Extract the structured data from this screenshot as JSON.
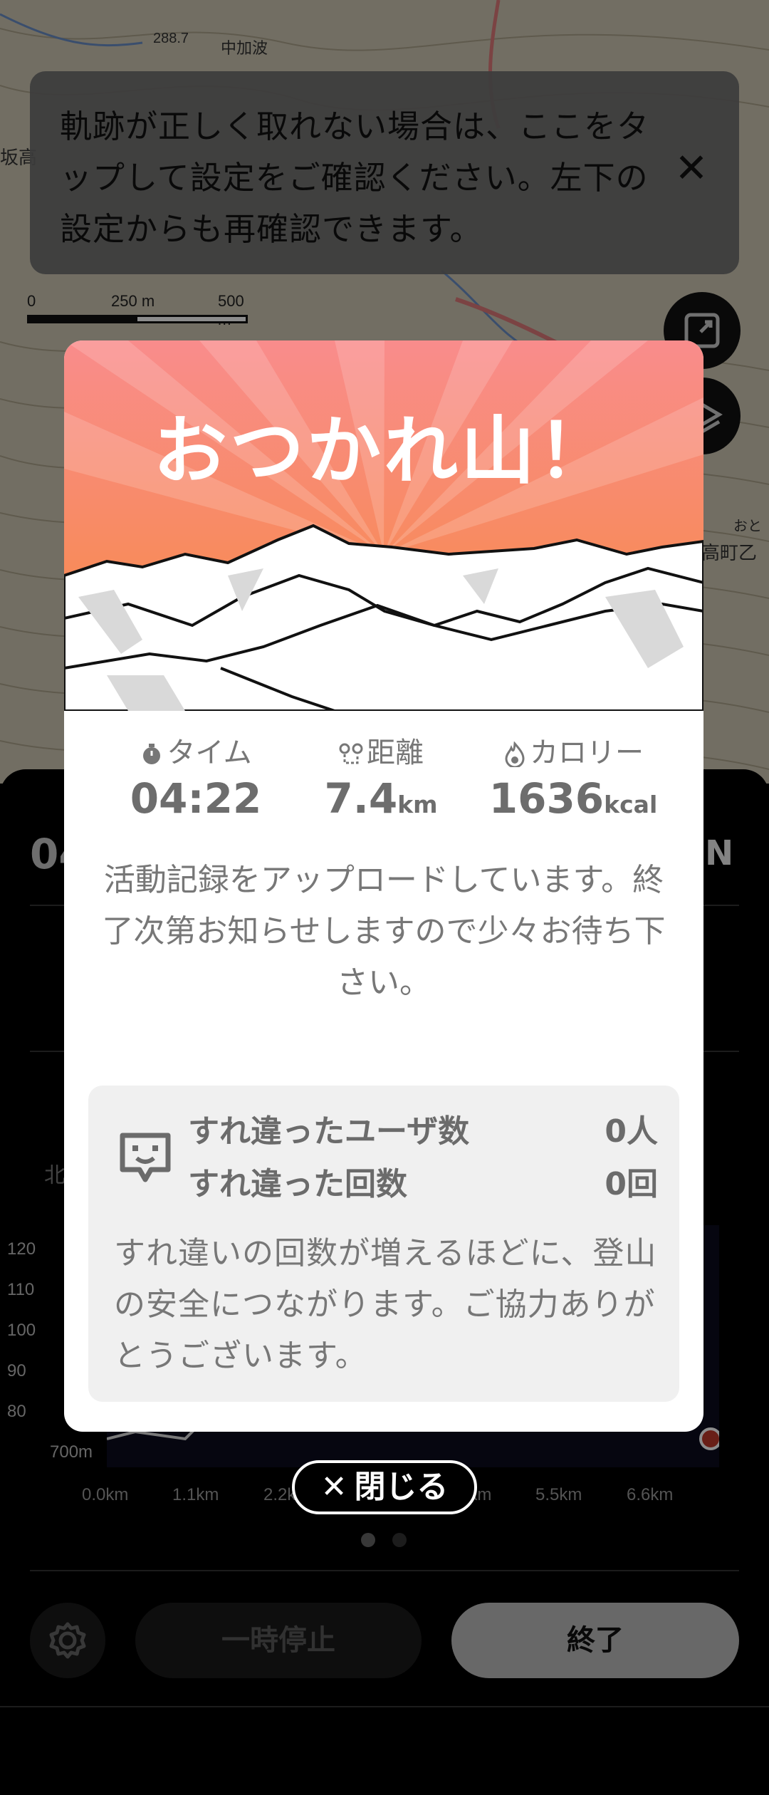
{
  "banner": {
    "text": "軌跡が正しく取れない場合は、ここをタップして設定をご確認ください。左下の設定からも再確認できます。",
    "close_icon": "close-icon"
  },
  "map": {
    "labels": [
      "中加波",
      "288.7",
      "高町乙",
      "おと",
      "坂高"
    ],
    "scale": {
      "l0": "0",
      "l1": "250 m",
      "l2": "500 m"
    }
  },
  "modal": {
    "title": "おつかれ山！",
    "stats": [
      {
        "label": "タイム",
        "icon": "stopwatch-icon",
        "value": "04:22",
        "unit": ""
      },
      {
        "label": "距離",
        "icon": "route-icon",
        "value": "7.4",
        "unit": "km"
      },
      {
        "label": "カロリー",
        "icon": "flame-icon",
        "value": "1636",
        "unit": "kcal"
      }
    ],
    "upload_message": "活動記録をアップロードしています。終了次第お知らせしますので少々お待ち下さい。",
    "encounter": {
      "users_label": "すれ違ったユーザ数",
      "users_value": "0人",
      "count_label": "すれ違った回数",
      "count_value": "0回",
      "note": "すれ違いの回数が増えるほどに、登山の安全につながります。ご協力ありがとうございます。"
    }
  },
  "close_button": {
    "label": "閉じる",
    "icon": "close-icon"
  },
  "panel": {
    "time_partial": "04",
    "brand_partial": "N",
    "north_label": "北",
    "y_labels": [
      "120",
      "110",
      "100",
      "90",
      "80",
      "700m"
    ],
    "x_labels": [
      "0.0km",
      "1.1km",
      "2.2km",
      "4.4km",
      "5.5km",
      "6.6km"
    ]
  },
  "controls": {
    "settings_icon": "gear-icon",
    "pause_label": "一時停止",
    "end_label": "終了"
  },
  "colors": {
    "hero_top": "#f98c8c",
    "hero_bottom": "#f78a3e",
    "modal_bg": "#ffffff",
    "end_button": "#bdbdbd"
  }
}
